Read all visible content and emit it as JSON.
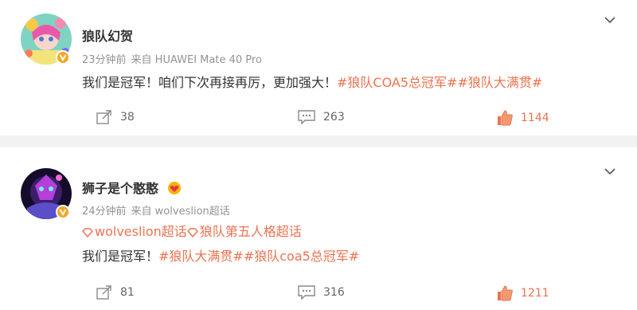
{
  "posts": [
    {
      "author": "狼队幻贺",
      "time": "23分钟前",
      "source": "来自 HUAWEI Mate 40 Pro",
      "text": "我们是冠军！咱们下次再接再厉，更加强大！",
      "tags": "#狼队COA5总冠军##狼队大满贯#",
      "reposts": "38",
      "comments": "263",
      "likes": "1144"
    },
    {
      "author": "狮子是个憨憨",
      "time": "24分钟前",
      "source": "来自 wolveslion超话",
      "topic1": "wolveslion超话",
      "topic2": "狼队第五人格超话",
      "text": "我们是冠军！",
      "tags": "#狼队大满贯##狼队coa5总冠军#",
      "reposts": "81",
      "comments": "316",
      "likes": "1211"
    }
  ],
  "colors": {
    "accent": "#eb7350",
    "verified": "#f5a623",
    "muted": "#939393"
  }
}
